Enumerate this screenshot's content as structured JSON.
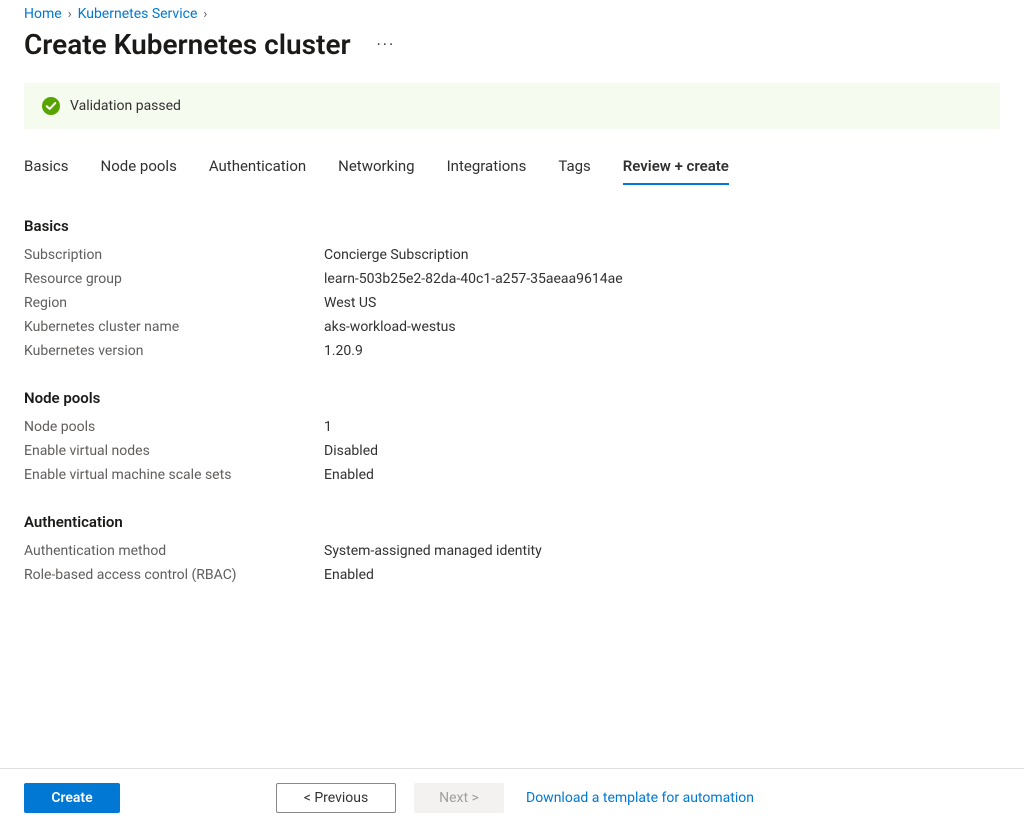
{
  "breadcrumb": {
    "home": "Home",
    "service": "Kubernetes Service"
  },
  "page_title": "Create Kubernetes cluster",
  "validation": {
    "message": "Validation passed"
  },
  "tabs": [
    {
      "label": "Basics",
      "active": false
    },
    {
      "label": "Node pools",
      "active": false
    },
    {
      "label": "Authentication",
      "active": false
    },
    {
      "label": "Networking",
      "active": false
    },
    {
      "label": "Integrations",
      "active": false
    },
    {
      "label": "Tags",
      "active": false
    },
    {
      "label": "Review + create",
      "active": true
    }
  ],
  "sections": {
    "basics": {
      "title": "Basics",
      "rows": [
        {
          "label": "Subscription",
          "value": "Concierge Subscription"
        },
        {
          "label": "Resource group",
          "value": "learn-503b25e2-82da-40c1-a257-35aeaa9614ae"
        },
        {
          "label": "Region",
          "value": "West US"
        },
        {
          "label": "Kubernetes cluster name",
          "value": "aks-workload-westus"
        },
        {
          "label": "Kubernetes version",
          "value": "1.20.9"
        }
      ]
    },
    "nodepools": {
      "title": "Node pools",
      "rows": [
        {
          "label": "Node pools",
          "value": "1"
        },
        {
          "label": "Enable virtual nodes",
          "value": "Disabled"
        },
        {
          "label": "Enable virtual machine scale sets",
          "value": "Enabled"
        }
      ]
    },
    "auth": {
      "title": "Authentication",
      "rows": [
        {
          "label": "Authentication method",
          "value": "System-assigned managed identity"
        },
        {
          "label": "Role-based access control (RBAC)",
          "value": "Enabled"
        }
      ]
    }
  },
  "footer": {
    "create": "Create",
    "previous": "<  Previous",
    "next": "Next  >",
    "download_link": "Download a template for automation"
  }
}
